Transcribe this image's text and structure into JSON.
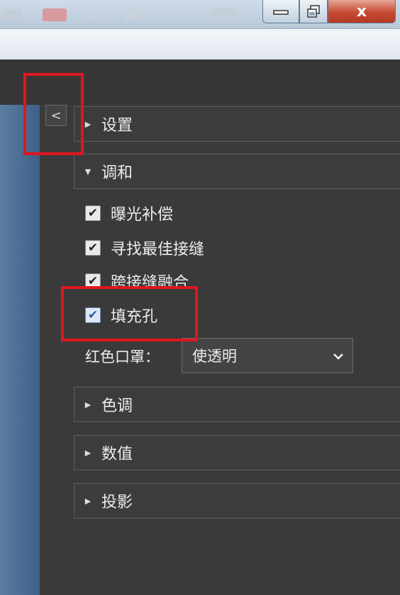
{
  "window": {
    "minimize_icon": "minimize-icon",
    "maximize_icon": "restore-icon",
    "close_icon": "close-icon",
    "close_glyph": "x"
  },
  "panel": {
    "collapse_glyph": "<",
    "sections": [
      {
        "label": "设置",
        "expanded": false
      },
      {
        "label": "调和",
        "expanded": true
      },
      {
        "label": "色调",
        "expanded": false
      },
      {
        "label": "数值",
        "expanded": false
      },
      {
        "label": "投影",
        "expanded": false
      }
    ],
    "checks": [
      {
        "label": "曝光补偿",
        "checked": true
      },
      {
        "label": "寻找最佳接缝",
        "checked": true
      },
      {
        "label": "跨接缝融合",
        "checked": true
      },
      {
        "label": "填充孔",
        "checked": true
      }
    ],
    "red_mask": {
      "label": "红色口罩：",
      "value": "使透明"
    }
  },
  "colors": {
    "highlight": "#e0151e",
    "panel_bg": "#3a3a3a",
    "accent_blue": "#2c5aa6"
  }
}
